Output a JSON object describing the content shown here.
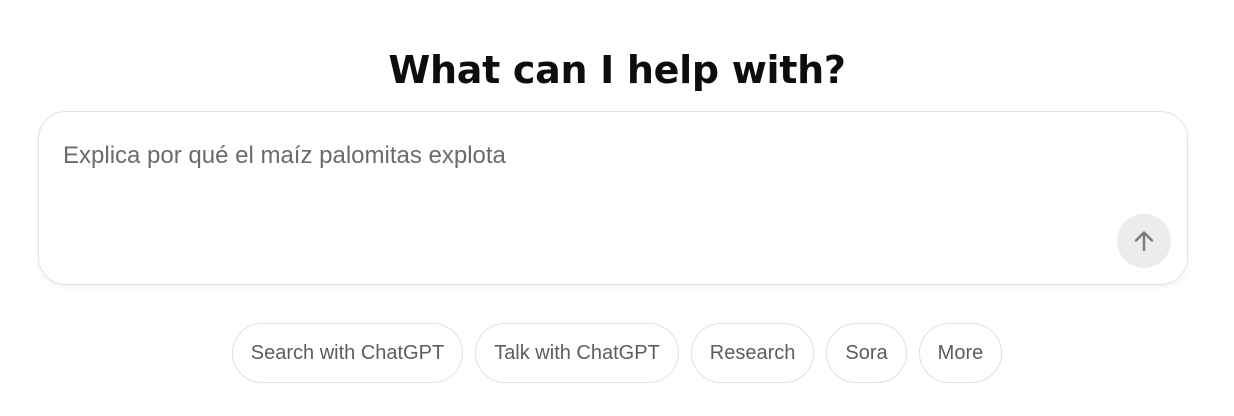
{
  "heading": "What can I help with?",
  "composer": {
    "placeholder": "Explica por qué el maíz palomitas explota",
    "value": "",
    "send_icon": "arrow-up-icon"
  },
  "suggestions": [
    {
      "label": "Search with ChatGPT"
    },
    {
      "label": "Talk with ChatGPT"
    },
    {
      "label": "Research"
    },
    {
      "label": "Sora"
    },
    {
      "label": "More"
    }
  ],
  "colors": {
    "text_primary": "#0d0d0d",
    "text_muted": "#6b6b6b",
    "chip_text": "#5d5d5d",
    "border": "#e3e3e3",
    "send_button_bg": "#ececec",
    "send_icon": "#7a7a7a"
  }
}
